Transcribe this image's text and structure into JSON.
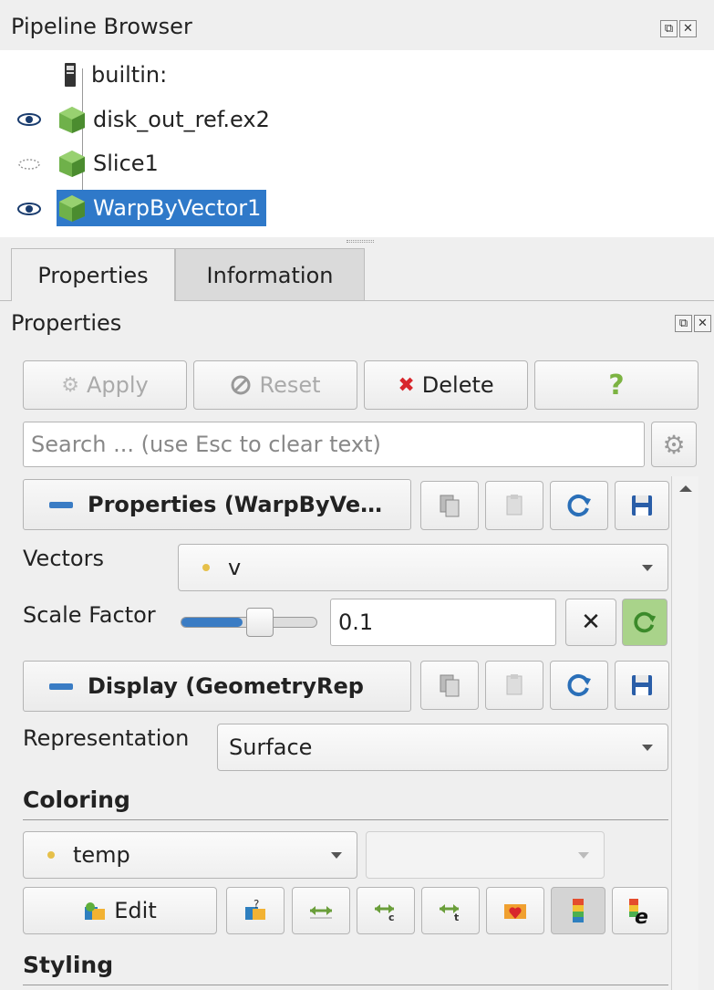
{
  "pipeline_browser": {
    "title": "Pipeline Browser",
    "items": [
      {
        "label": "builtin:",
        "icon": "server-icon",
        "eye": "none"
      },
      {
        "label": "disk_out_ref.ex2",
        "icon": "cube-icon",
        "eye": "visible"
      },
      {
        "label": "Slice1",
        "icon": "cube-icon",
        "eye": "hidden"
      },
      {
        "label": "WarpByVector1",
        "icon": "cube-icon",
        "eye": "visible",
        "selected": true
      }
    ]
  },
  "tabs": [
    {
      "label": "Properties",
      "active": true
    },
    {
      "label": "Information",
      "active": false
    }
  ],
  "properties_panel": {
    "title": "Properties",
    "buttons": {
      "apply": "Apply",
      "reset": "Reset",
      "delete": "Delete",
      "help": "?"
    },
    "search_placeholder": "Search ... (use Esc to clear text)",
    "properties_section": "Properties (WarpByVe…",
    "vectors_label": "Vectors",
    "vectors_value": "v",
    "scale_factor_label": "Scale Factor",
    "scale_factor_value": "0.1",
    "scale_factor_slider": 0.45,
    "display_section": "Display (GeometryRep",
    "representation_label": "Representation",
    "representation_value": "Surface",
    "coloring_label": "Coloring",
    "coloring_value": "temp",
    "coloring_component": "",
    "edit_label": "Edit",
    "styling_label": "Styling"
  },
  "colors": {
    "selection": "#2f79c9",
    "accent_blue": "#3a7cc4",
    "delete_red": "#d8262c",
    "help_green": "#7cb342",
    "dot_yellow": "#e6c04a"
  }
}
